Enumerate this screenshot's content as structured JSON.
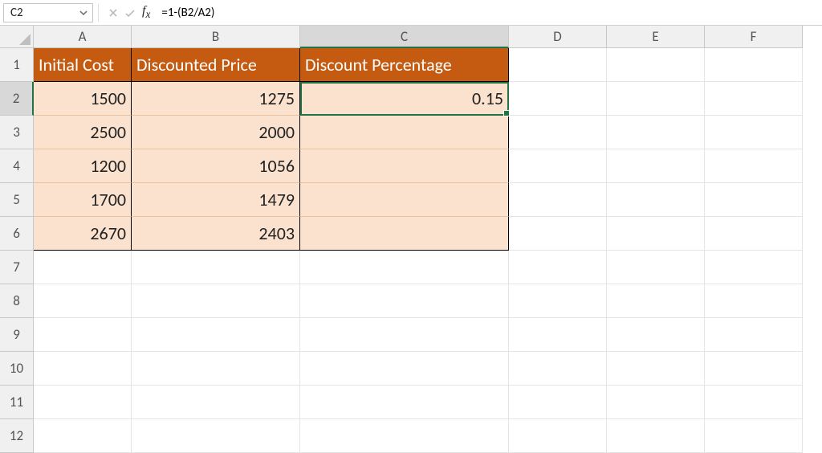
{
  "formula_bar": {
    "name_box_value": "C2",
    "formula": "=1-(B2/A2)"
  },
  "columns": [
    "A",
    "B",
    "C",
    "D",
    "E",
    "F"
  ],
  "rows": [
    "1",
    "2",
    "3",
    "4",
    "5",
    "6",
    "7",
    "8",
    "9",
    "10",
    "11",
    "12"
  ],
  "selected_cell": "C2",
  "headers": {
    "A": "Initial Cost",
    "B": "Discounted Price",
    "C": "Discount Percentage"
  },
  "data": {
    "A": [
      "1500",
      "2500",
      "1200",
      "1700",
      "2670"
    ],
    "B": [
      "1275",
      "2000",
      "1056",
      "1479",
      "2403"
    ],
    "C": [
      "0.15",
      "",
      "",
      "",
      ""
    ]
  }
}
